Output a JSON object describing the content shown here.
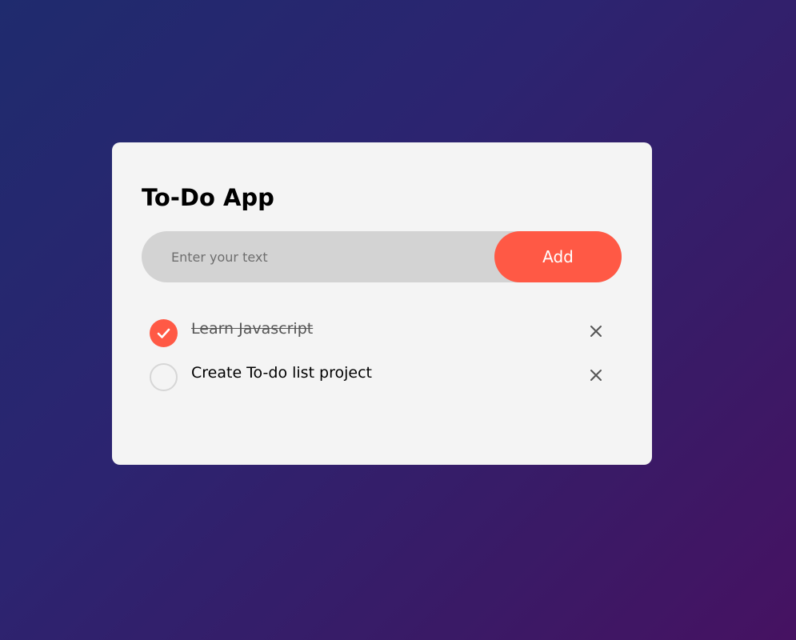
{
  "app": {
    "title": "To-Do App"
  },
  "input": {
    "placeholder": "Enter your text",
    "value": ""
  },
  "add_button": {
    "label": "Add"
  },
  "tasks": [
    {
      "text": "Learn Javascript",
      "completed": true
    },
    {
      "text": "Create To-do list project",
      "completed": false
    }
  ],
  "icons": {
    "check": "check-icon",
    "delete": "close-icon"
  },
  "colors": {
    "accent": "#ff5945",
    "card_background": "#f4f4f4",
    "input_background": "#d3d3d3",
    "page_gradient_start": "#1f2b6e",
    "page_gradient_end": "#461262"
  }
}
